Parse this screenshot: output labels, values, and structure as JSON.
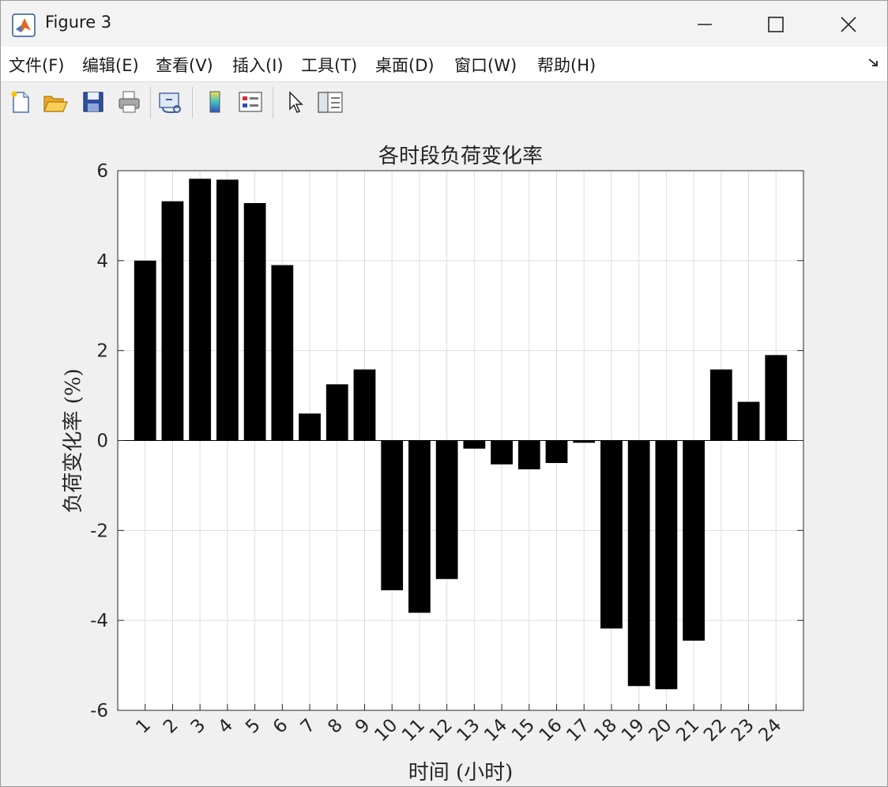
{
  "window": {
    "title": "Figure 3"
  },
  "menu": [
    "文件(F)",
    "编辑(E)",
    "查看(V)",
    "插入(I)",
    "工具(T)",
    "桌面(D)",
    "窗口(W)",
    "帮助(H)"
  ],
  "toolbar": {
    "tools": [
      "new-figure-icon",
      "open-icon",
      "save-icon",
      "print-icon",
      "link-plot-icon",
      "colorbar-icon",
      "legend-icon",
      "select-arrow-icon",
      "property-editor-icon"
    ]
  },
  "chart_data": {
    "type": "bar",
    "title": "各时段负荷变化率",
    "xlabel": "时间 (小时)",
    "ylabel": "负荷变化率 (%)",
    "categories": [
      "1",
      "2",
      "3",
      "4",
      "5",
      "6",
      "7",
      "8",
      "9",
      "10",
      "11",
      "12",
      "13",
      "14",
      "15",
      "16",
      "17",
      "18",
      "19",
      "20",
      "21",
      "22",
      "23",
      "24"
    ],
    "values": [
      4.0,
      5.32,
      5.82,
      5.8,
      5.28,
      3.9,
      0.6,
      1.25,
      1.58,
      -3.33,
      -3.83,
      -3.08,
      -0.18,
      -0.53,
      -0.64,
      -0.5,
      -0.05,
      -4.18,
      -5.46,
      -5.53,
      -4.45,
      1.58,
      0.86,
      1.9
    ],
    "ylim": [
      -6,
      6
    ],
    "yticks": [
      "-6",
      "-4",
      "-2",
      "0",
      "2",
      "4",
      "6"
    ],
    "grid": true,
    "bar_color": "#000000"
  }
}
